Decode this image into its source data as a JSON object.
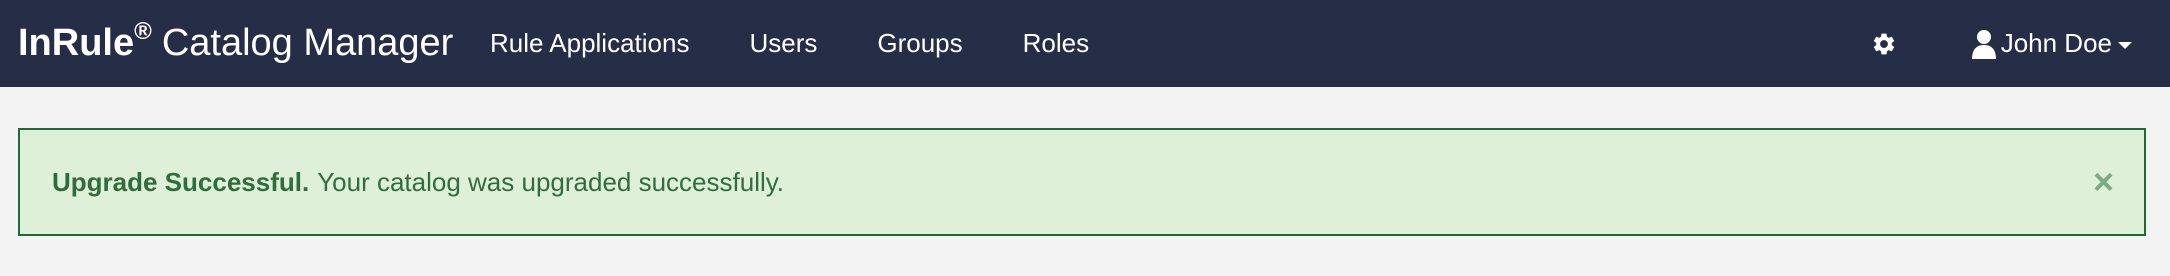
{
  "navbar": {
    "brand": {
      "name": "InRule",
      "registered": "®",
      "product": "Catalog Manager"
    },
    "links": [
      {
        "label": "Rule Applications"
      },
      {
        "label": "Users"
      },
      {
        "label": "Groups"
      },
      {
        "label": "Roles"
      }
    ],
    "settings_icon": "gear-icon",
    "user": {
      "icon": "user-icon",
      "name": "John Doe"
    }
  },
  "alert": {
    "strong": "Upgrade Successful.",
    "message": "Your catalog was upgraded successfully.",
    "close": "×"
  },
  "colors": {
    "navbar_bg": "#252d47",
    "page_bg": "#f3f3f3",
    "alert_bg": "#dff0d8",
    "alert_border": "#1e6b34",
    "alert_text": "#2f6d3c"
  }
}
